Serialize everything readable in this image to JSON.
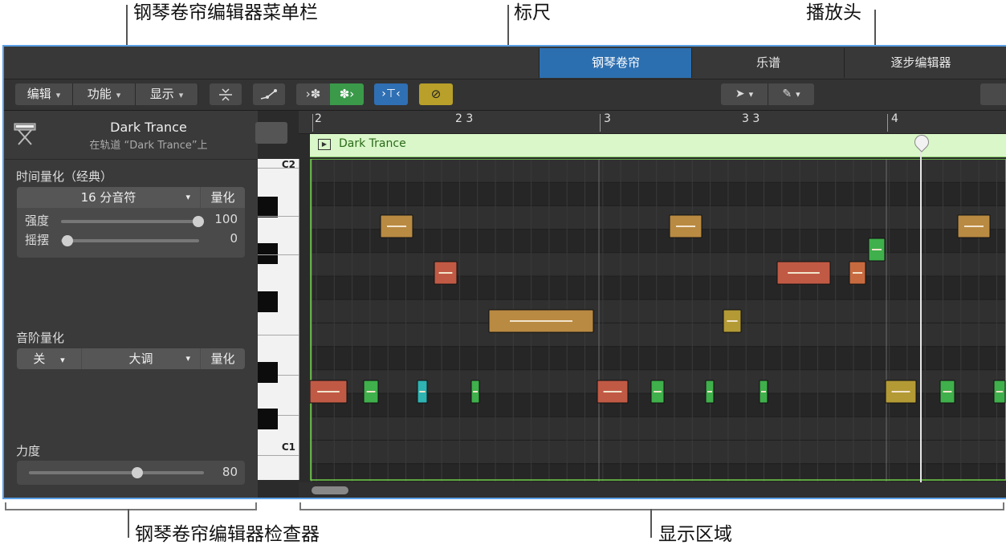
{
  "callouts": {
    "menubar": "钢琴卷帘编辑器菜单栏",
    "ruler": "标尺",
    "playhead": "播放头",
    "inspector": "钢琴卷帘编辑器检查器",
    "display": "显示区域"
  },
  "tabs": [
    {
      "label": "钢琴卷帘",
      "active": true
    },
    {
      "label": "乐谱",
      "active": false
    },
    {
      "label": "逐步编辑器",
      "active": false
    }
  ],
  "toolbar": {
    "menus": [
      "编辑",
      "功能",
      "显示"
    ]
  },
  "track": {
    "name": "Dark Trance",
    "subtitle": "在轨道 “Dark Trance”上"
  },
  "inspector": {
    "time_quant_title": "时间量化（经典）",
    "time_quant_value": "16 分音符",
    "quant_button": "量化",
    "strength_label": "强度",
    "strength_value": "100",
    "swing_label": "摇摆",
    "swing_value": "0",
    "scale_quant_title": "音阶量化",
    "scale_off": "关",
    "scale_type": "大调",
    "scale_quant_button": "量化",
    "velocity_title": "力度",
    "velocity_value": "80"
  },
  "keyboard": {
    "c2": "C2",
    "c1": "C1"
  },
  "ruler": {
    "labels": [
      "2",
      "2 3",
      "3",
      "3 3",
      "4"
    ]
  },
  "region": {
    "name": "Dark Trance"
  },
  "colors": {
    "accent_blue": "#2c6fb0",
    "region_green": "#d9f7c8",
    "note_orange": "#b98a42",
    "note_red": "#c15a45",
    "note_green": "#3fb04b",
    "note_teal": "#2fb3b3",
    "note_yellow": "#b39a35"
  }
}
